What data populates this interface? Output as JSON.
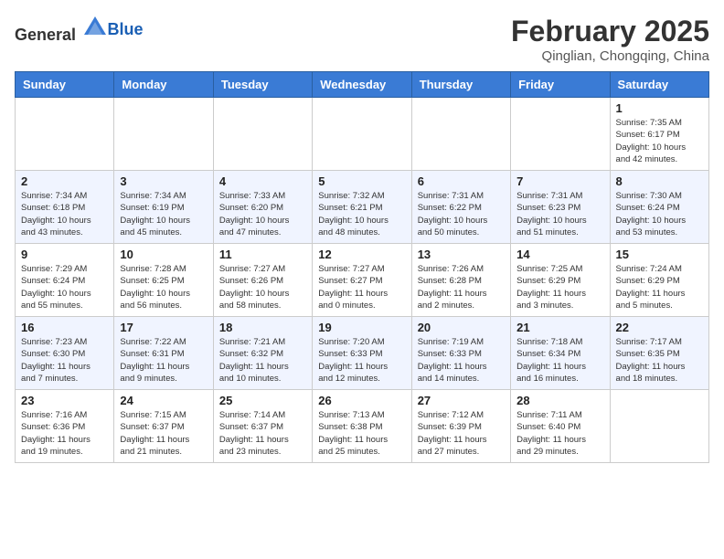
{
  "header": {
    "logo_general": "General",
    "logo_blue": "Blue",
    "month_title": "February 2025",
    "location": "Qinglian, Chongqing, China"
  },
  "weekdays": [
    "Sunday",
    "Monday",
    "Tuesday",
    "Wednesday",
    "Thursday",
    "Friday",
    "Saturday"
  ],
  "weeks": [
    [
      {
        "day": "",
        "info": ""
      },
      {
        "day": "",
        "info": ""
      },
      {
        "day": "",
        "info": ""
      },
      {
        "day": "",
        "info": ""
      },
      {
        "day": "",
        "info": ""
      },
      {
        "day": "",
        "info": ""
      },
      {
        "day": "1",
        "info": "Sunrise: 7:35 AM\nSunset: 6:17 PM\nDaylight: 10 hours\nand 42 minutes."
      }
    ],
    [
      {
        "day": "2",
        "info": "Sunrise: 7:34 AM\nSunset: 6:18 PM\nDaylight: 10 hours\nand 43 minutes."
      },
      {
        "day": "3",
        "info": "Sunrise: 7:34 AM\nSunset: 6:19 PM\nDaylight: 10 hours\nand 45 minutes."
      },
      {
        "day": "4",
        "info": "Sunrise: 7:33 AM\nSunset: 6:20 PM\nDaylight: 10 hours\nand 47 minutes."
      },
      {
        "day": "5",
        "info": "Sunrise: 7:32 AM\nSunset: 6:21 PM\nDaylight: 10 hours\nand 48 minutes."
      },
      {
        "day": "6",
        "info": "Sunrise: 7:31 AM\nSunset: 6:22 PM\nDaylight: 10 hours\nand 50 minutes."
      },
      {
        "day": "7",
        "info": "Sunrise: 7:31 AM\nSunset: 6:23 PM\nDaylight: 10 hours\nand 51 minutes."
      },
      {
        "day": "8",
        "info": "Sunrise: 7:30 AM\nSunset: 6:24 PM\nDaylight: 10 hours\nand 53 minutes."
      }
    ],
    [
      {
        "day": "9",
        "info": "Sunrise: 7:29 AM\nSunset: 6:24 PM\nDaylight: 10 hours\nand 55 minutes."
      },
      {
        "day": "10",
        "info": "Sunrise: 7:28 AM\nSunset: 6:25 PM\nDaylight: 10 hours\nand 56 minutes."
      },
      {
        "day": "11",
        "info": "Sunrise: 7:27 AM\nSunset: 6:26 PM\nDaylight: 10 hours\nand 58 minutes."
      },
      {
        "day": "12",
        "info": "Sunrise: 7:27 AM\nSunset: 6:27 PM\nDaylight: 11 hours\nand 0 minutes."
      },
      {
        "day": "13",
        "info": "Sunrise: 7:26 AM\nSunset: 6:28 PM\nDaylight: 11 hours\nand 2 minutes."
      },
      {
        "day": "14",
        "info": "Sunrise: 7:25 AM\nSunset: 6:29 PM\nDaylight: 11 hours\nand 3 minutes."
      },
      {
        "day": "15",
        "info": "Sunrise: 7:24 AM\nSunset: 6:29 PM\nDaylight: 11 hours\nand 5 minutes."
      }
    ],
    [
      {
        "day": "16",
        "info": "Sunrise: 7:23 AM\nSunset: 6:30 PM\nDaylight: 11 hours\nand 7 minutes."
      },
      {
        "day": "17",
        "info": "Sunrise: 7:22 AM\nSunset: 6:31 PM\nDaylight: 11 hours\nand 9 minutes."
      },
      {
        "day": "18",
        "info": "Sunrise: 7:21 AM\nSunset: 6:32 PM\nDaylight: 11 hours\nand 10 minutes."
      },
      {
        "day": "19",
        "info": "Sunrise: 7:20 AM\nSunset: 6:33 PM\nDaylight: 11 hours\nand 12 minutes."
      },
      {
        "day": "20",
        "info": "Sunrise: 7:19 AM\nSunset: 6:33 PM\nDaylight: 11 hours\nand 14 minutes."
      },
      {
        "day": "21",
        "info": "Sunrise: 7:18 AM\nSunset: 6:34 PM\nDaylight: 11 hours\nand 16 minutes."
      },
      {
        "day": "22",
        "info": "Sunrise: 7:17 AM\nSunset: 6:35 PM\nDaylight: 11 hours\nand 18 minutes."
      }
    ],
    [
      {
        "day": "23",
        "info": "Sunrise: 7:16 AM\nSunset: 6:36 PM\nDaylight: 11 hours\nand 19 minutes."
      },
      {
        "day": "24",
        "info": "Sunrise: 7:15 AM\nSunset: 6:37 PM\nDaylight: 11 hours\nand 21 minutes."
      },
      {
        "day": "25",
        "info": "Sunrise: 7:14 AM\nSunset: 6:37 PM\nDaylight: 11 hours\nand 23 minutes."
      },
      {
        "day": "26",
        "info": "Sunrise: 7:13 AM\nSunset: 6:38 PM\nDaylight: 11 hours\nand 25 minutes."
      },
      {
        "day": "27",
        "info": "Sunrise: 7:12 AM\nSunset: 6:39 PM\nDaylight: 11 hours\nand 27 minutes."
      },
      {
        "day": "28",
        "info": "Sunrise: 7:11 AM\nSunset: 6:40 PM\nDaylight: 11 hours\nand 29 minutes."
      },
      {
        "day": "",
        "info": ""
      }
    ]
  ]
}
